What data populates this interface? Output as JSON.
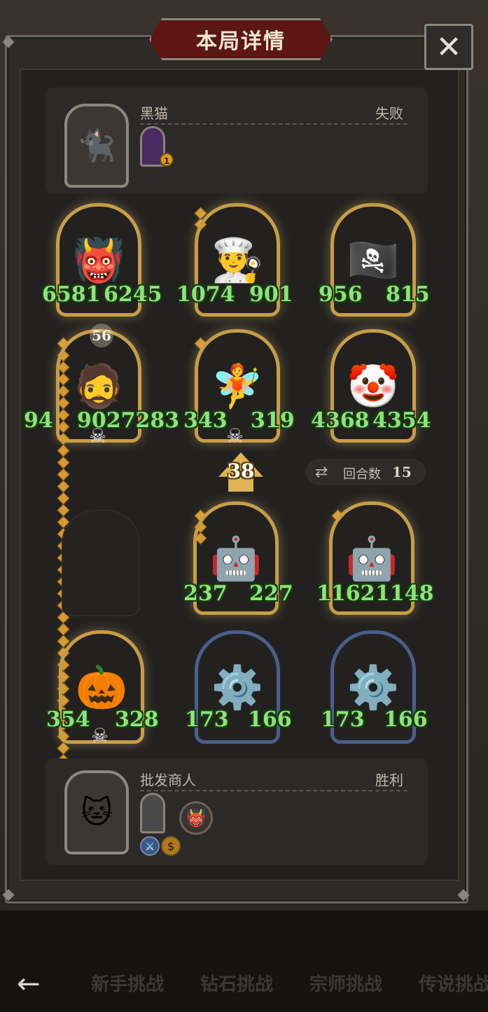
{
  "title": "本局详情",
  "close_symbol": "✕",
  "opponent": {
    "name": "黑猫",
    "result": "失败",
    "portrait_icon": "🐈‍⬛",
    "mini_badge": "1"
  },
  "player": {
    "name": "批发商人",
    "result": "胜利",
    "portrait_icon": "🐱",
    "trinket_icon": "👹"
  },
  "opponent_cards": [
    {
      "icon": "👹",
      "attack": "6581",
      "health": "6245"
    },
    {
      "icon": "👨‍🍳",
      "attack": "1074",
      "health": "901"
    },
    {
      "icon": "🏴‍☠️",
      "attack": "956",
      "health": "815"
    },
    {
      "icon": "🧔",
      "attack": "94",
      "health": "9027283"
    },
    {
      "icon": "🧚",
      "attack": "343",
      "health": "319"
    },
    {
      "icon": "🤡",
      "attack": "4368",
      "health": "4354"
    }
  ],
  "player_cards": [
    {
      "icon": "🤖",
      "attack": "237",
      "health": "227"
    },
    {
      "icon": "🤖",
      "attack": "1162",
      "health": "1148"
    },
    {
      "icon": "🎃",
      "attack": "354",
      "health": "328"
    },
    {
      "icon": "⚙️",
      "attack": "173",
      "health": "166"
    },
    {
      "icon": "⚙️",
      "attack": "173",
      "health": "166"
    }
  ],
  "attack_arrow_value": "38",
  "attack_badge_value": "56",
  "rounds": {
    "label": "回合数",
    "value": "15"
  },
  "tabs": [
    "新手挑战",
    "钻石挑战",
    "宗师挑战",
    "传说挑战"
  ],
  "colors": {
    "stat_green": "#8ee27a",
    "gold_border": "#c79d46",
    "title_red": "#5c1614"
  }
}
